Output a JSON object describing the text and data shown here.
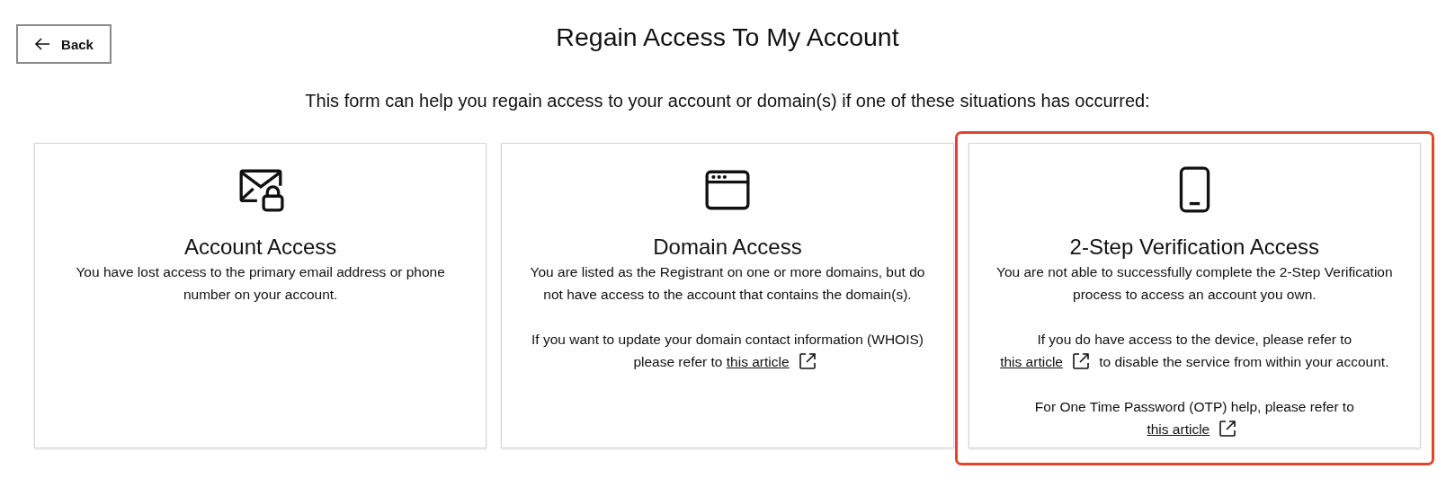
{
  "back_button": {
    "label": "Back"
  },
  "title": "Regain Access To My Account",
  "intro": "This form can help you regain access to your account or domain(s) if one of these situations has occurred:",
  "cards": [
    {
      "kind": "mail-lock",
      "title": "Account Access",
      "highlighted": false,
      "paragraphs": [
        [
          {
            "kind": "text",
            "text": "You have lost access to the primary email address or phone number on your account."
          }
        ]
      ]
    },
    {
      "kind": "browser",
      "title": "Domain Access",
      "highlighted": false,
      "paragraphs": [
        [
          {
            "kind": "text",
            "text": "You are listed as the Registrant on one or more domains, but do not have access to the account that contains the domain(s)."
          }
        ],
        [
          {
            "kind": "text",
            "text": "If you want to update your domain contact information (WHOIS) please refer to "
          },
          {
            "kind": "link",
            "text": "this article"
          }
        ]
      ]
    },
    {
      "kind": "phone",
      "title": "2-Step Verification Access",
      "highlighted": true,
      "paragraphs": [
        [
          {
            "kind": "text",
            "text": "You are not able to successfully complete the 2-Step Verification process to access an account you own."
          }
        ],
        [
          {
            "kind": "text",
            "text": "If you do have access to the device, please refer to "
          },
          {
            "kind": "link",
            "text": "this article"
          },
          {
            "kind": "text",
            "text": " to disable the service from within your account."
          }
        ],
        [
          {
            "kind": "text",
            "text": "For One Time Password (OTP) help, please refer to "
          },
          {
            "kind": "link",
            "text": "this article"
          }
        ]
      ]
    }
  ]
}
